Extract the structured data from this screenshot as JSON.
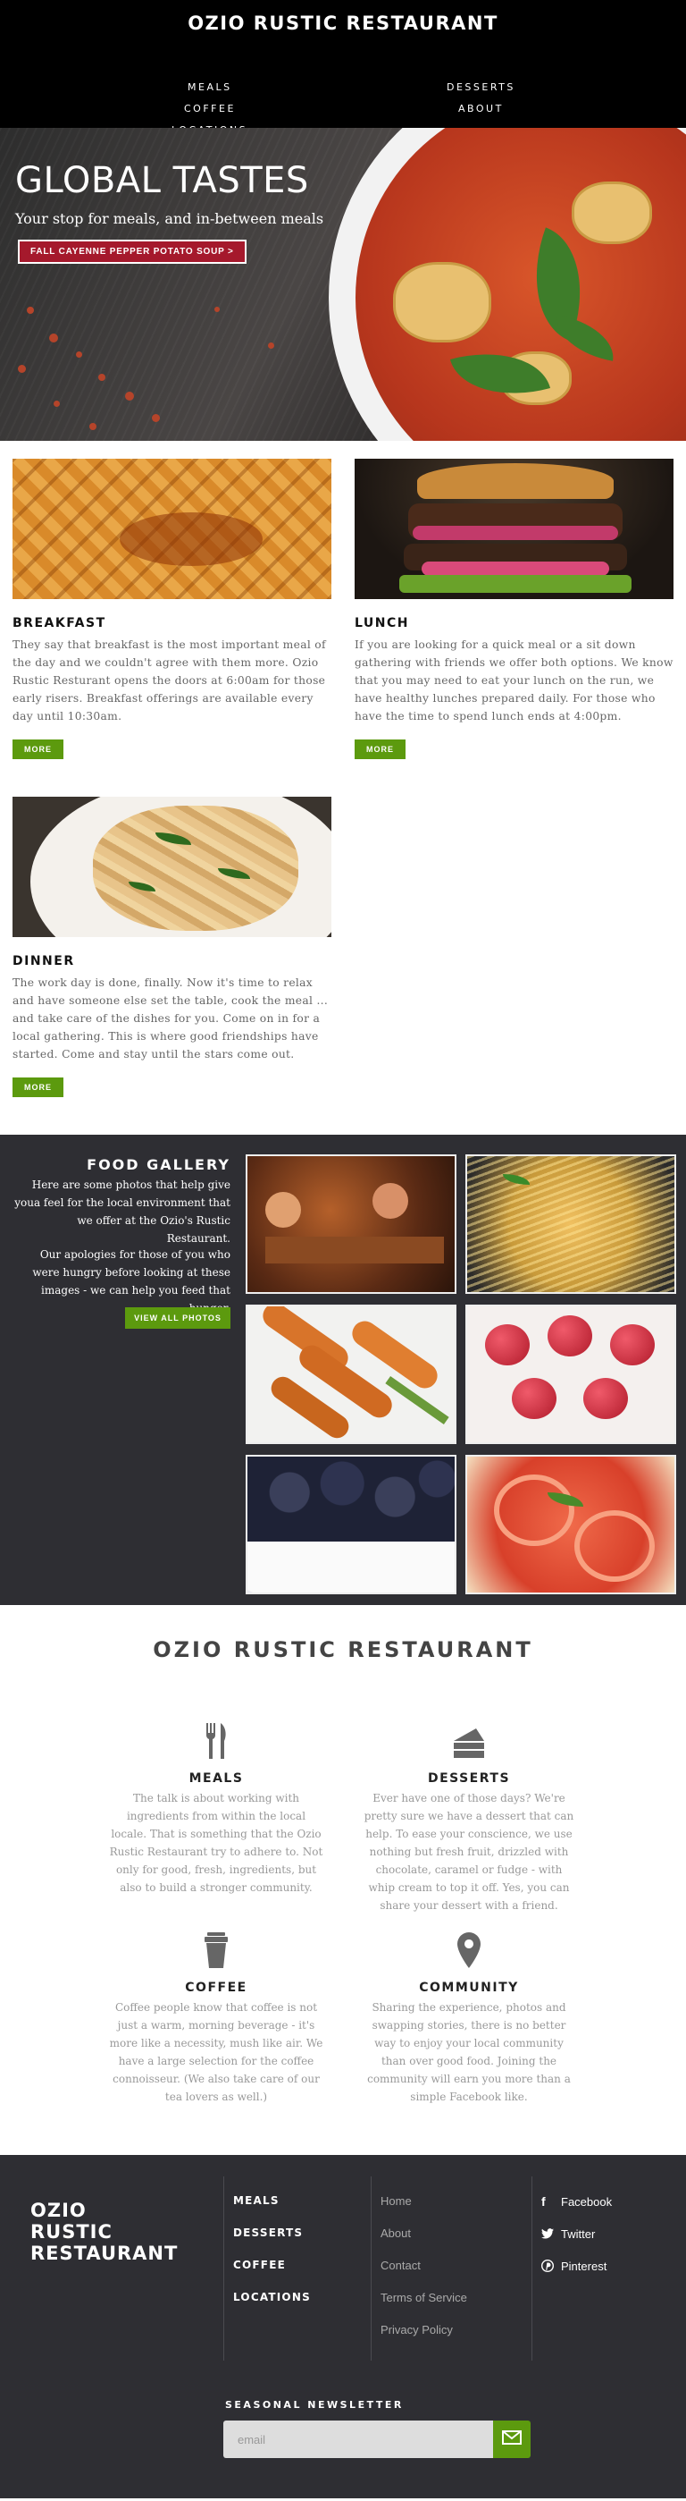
{
  "header": {
    "brand": "Ozio Rustic Restaurant",
    "nav": {
      "meals": "Meals",
      "coffee": "Coffee",
      "locations": "Locations",
      "desserts": "Desserts",
      "about": "About"
    }
  },
  "hero": {
    "title": "GLOBAL TASTES",
    "subtitle": "Your stop for meals, and in-between meals",
    "cta": "Fall Cayenne Pepper Potato Soup >"
  },
  "meals": [
    {
      "title": "Breakfast",
      "text": "They say that breakfast is the most important meal of the day and we couldn't agree with them more. Ozio Rustic Resturant opens the doors at 6:00am for those early risers. Breakfast offerings are available every day until 10:30am.",
      "button": "More"
    },
    {
      "title": "Lunch",
      "text": "If you are looking for a quick meal or a sit down gathering with friends we offer both options. We know that you may need to eat your lunch on the run, we have healthy lunches prepared daily. For those who have the time to spend lunch ends at 4:00pm.",
      "button": "More"
    },
    {
      "title": "Dinner",
      "text": "The work day is done, finally. Now it's time to relax and have someone else set the table, cook the meal ... and take care of the dishes for you. Come on in for a local gathering. This is where good friendships have started. Come and stay until the stars come out.",
      "button": "More"
    }
  ],
  "gallery": {
    "title": "Food Gallery",
    "text1": "Here are some photos that help give youa feel for the local environment that we offer at the Ozio's Rustic Restaurant.",
    "text2": "Our apologies for those of you who were hungry before looking at these images - we can help you feed that hunger.",
    "button": "View All Photos"
  },
  "services": {
    "heading": "Ozio Rustic Restaurant",
    "items": [
      {
        "icon": "fork-knife-icon",
        "title": "Meals",
        "text": "The talk is about working with ingredients from within the local locale. That is something that the Ozio Rustic Restaurant try to adhere to. Not only for good, fresh, ingredients, but also to build a stronger community."
      },
      {
        "icon": "cake-slice-icon",
        "title": "Desserts",
        "text": "Ever have one of those days? We're pretty sure we have a dessert that can help. To ease your conscience, we use nothing but fresh fruit, drizzled with chocolate, caramel or fudge - with whip cream to top it off. Yes, you can share your dessert with a friend."
      },
      {
        "icon": "coffee-cup-icon",
        "title": "Coffee",
        "text": "Coffee people know that coffee is not just a warm, morning beverage - it's more like a necessity, mush like air. We have a large selection for the coffee connoisseur. (We also take care of our tea lovers as well.)"
      },
      {
        "icon": "map-pin-icon",
        "title": "Community",
        "text": "Sharing the experience, photos and swapping stories, there is no better way to enjoy your local community than over good food. Joining the community will earn you more than a simple Facebook like."
      }
    ]
  },
  "footer": {
    "brand_line1": "Ozio",
    "brand_line2": "Rustic",
    "brand_line3": "Restaurant",
    "col1": [
      "Meals",
      "Desserts",
      "Coffee",
      "Locations"
    ],
    "col2": [
      "Home",
      "About",
      "Contact",
      "Terms of Service",
      "Privacy Policy"
    ],
    "social": [
      {
        "icon": "facebook-icon",
        "label": "Facebook"
      },
      {
        "icon": "twitter-icon",
        "label": "Twitter"
      },
      {
        "icon": "pinterest-icon",
        "label": "Pinterest"
      }
    ],
    "newsletter_title": "Seasonal Newsletter",
    "newsletter_placeholder": "email"
  },
  "colors": {
    "accent_green": "#5c9a0e",
    "hero_red": "#a5192c",
    "dark_bg": "#2e2e33"
  }
}
